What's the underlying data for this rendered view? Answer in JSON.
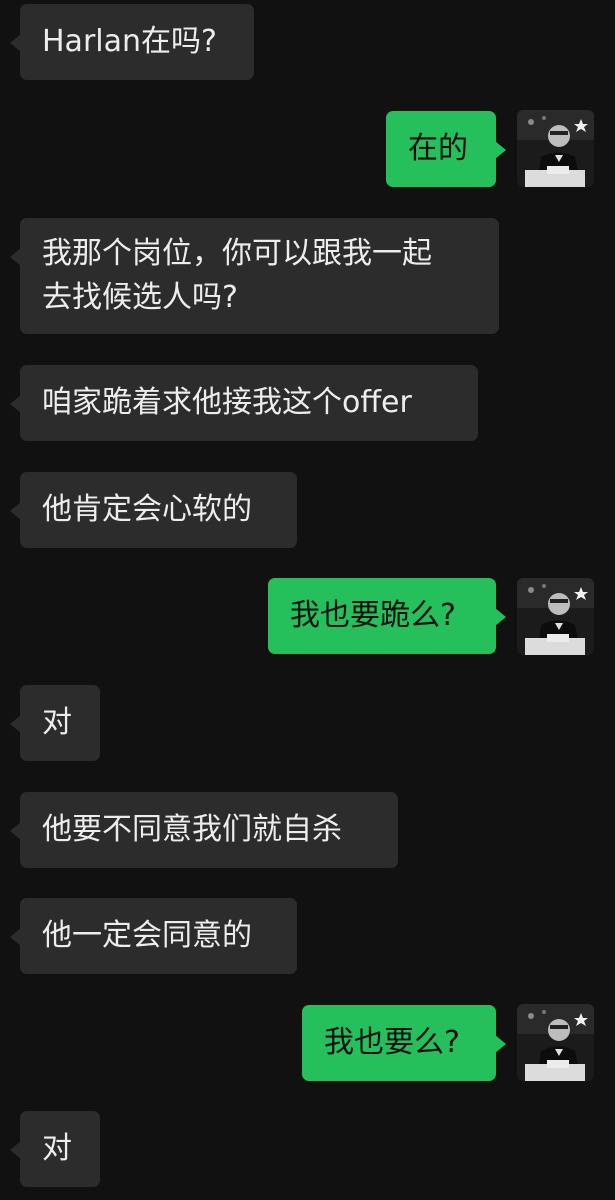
{
  "chat": {
    "messages": [
      {
        "side": "in",
        "text": "Harlan在吗?"
      },
      {
        "side": "out",
        "text": "在的"
      },
      {
        "side": "in",
        "text": "我那个岗位，你可以跟我一起\n去找候选人吗?"
      },
      {
        "side": "in",
        "text": "咱家跪着求他接我这个offer"
      },
      {
        "side": "in",
        "text": "他肯定会心软的"
      },
      {
        "side": "out",
        "text": "我也要跪么?"
      },
      {
        "side": "in",
        "text": "对"
      },
      {
        "side": "in",
        "text": "他要不同意我们就自杀"
      },
      {
        "side": "in",
        "text": "他一定会同意的"
      },
      {
        "side": "out",
        "text": "我也要么?"
      },
      {
        "side": "in",
        "text": "对"
      }
    ],
    "self_avatar_icon": "user-avatar-photo"
  },
  "colors": {
    "background": "#111111",
    "incoming_bubble": "#2c2c2c",
    "outgoing_bubble": "#25bf5b",
    "incoming_text": "#ededed",
    "outgoing_text": "#111111"
  }
}
